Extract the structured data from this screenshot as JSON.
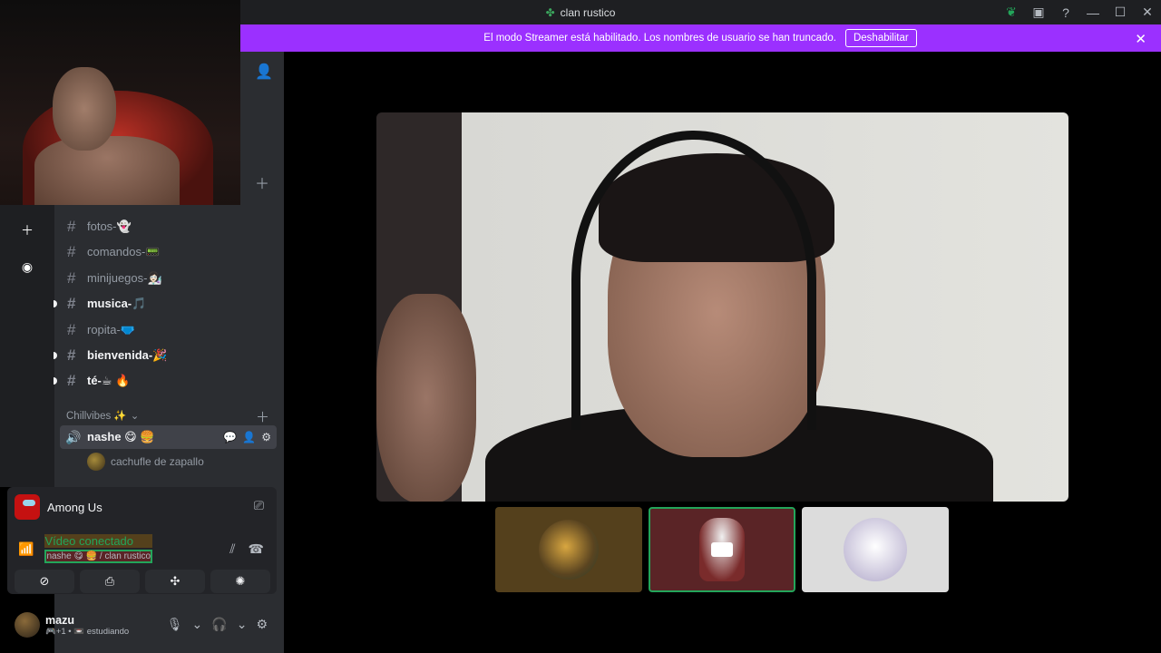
{
  "titlebar": {
    "title": "clan rustico",
    "title_icon": "leaf-icon",
    "icons": [
      "nitro-leaf-icon",
      "inbox-icon",
      "help-icon",
      "minimize-icon",
      "maximize-icon",
      "close-icon"
    ]
  },
  "banner": {
    "message": "El modo Streamer está habilitado. Los nombres de usuario se han truncado.",
    "button": "Deshabilitar",
    "color": "#9b30ff"
  },
  "channels": [
    {
      "name": "fotos-👻",
      "unread": false
    },
    {
      "name": "comandos-📟",
      "unread": false
    },
    {
      "name": "minijuegos-👩🏻‍🔬",
      "unread": false
    },
    {
      "name": "musica-🎵",
      "unread": true
    },
    {
      "name": "ropita-🩲",
      "unread": false
    },
    {
      "name": "bienvenida-🎉",
      "unread": true
    },
    {
      "name": "té-☕ 🔥",
      "unread": true
    }
  ],
  "category": {
    "name": "Chillvibes ✨"
  },
  "voice_channel": {
    "name": "nashe 😋 🍔"
  },
  "members": [
    {
      "name": "cachufle de zapallo"
    }
  ],
  "activity": {
    "game": "Among Us",
    "status": "Vídeo conectado",
    "location": "nashe 😋 🍔 / clan rustico"
  },
  "user": {
    "name": "mazu",
    "status": "🎮+1 • 📼 estudiando"
  },
  "colors": {
    "accent_green": "#23a55a",
    "sidebar": "#2b2d31",
    "rail": "#1e1f22"
  }
}
